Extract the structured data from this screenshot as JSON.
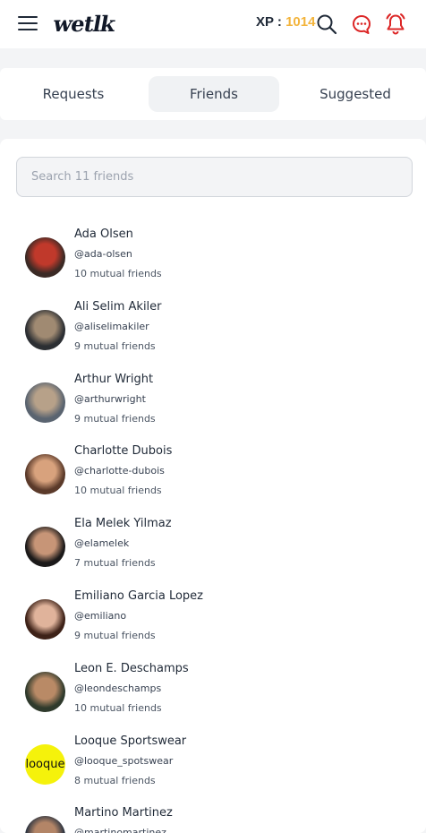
{
  "app": {
    "logo": "wetlk",
    "xp_label": "XP : ",
    "xp_value": "1014",
    "icons": [
      "menu-icon",
      "search-icon",
      "chat-icon",
      "bell-icon"
    ],
    "accent_color": "#dc2626",
    "xp_color": "#f3b43c"
  },
  "tabs": [
    {
      "label": "Requests",
      "active": false
    },
    {
      "label": "Friends",
      "active": true
    },
    {
      "label": "Suggested",
      "active": false
    }
  ],
  "search": {
    "placeholder": "Search 11 friends",
    "value": ""
  },
  "friends": [
    {
      "name": "Ada Olsen",
      "username": "@ada-olsen",
      "mutual": "10 mutual friends",
      "avatar_colors": [
        "#3b2a25",
        "#c0392b"
      ]
    },
    {
      "name": "Ali Selim Akiler",
      "username": "@aliselimakiler",
      "mutual": "9 mutual friends",
      "avatar_colors": [
        "#2c2f33",
        "#a08a72"
      ]
    },
    {
      "name": "Arthur Wright",
      "username": "@arthurwright",
      "mutual": "9 mutual friends",
      "avatar_colors": [
        "#5a6470",
        "#b7a189"
      ]
    },
    {
      "name": "Charlotte Dubois",
      "username": "@charlotte-dubois",
      "mutual": "10 mutual friends",
      "avatar_colors": [
        "#5b3a2a",
        "#d8a27d"
      ]
    },
    {
      "name": "Ela Melek Yilmaz",
      "username": "@elamelek",
      "mutual": "7 mutual friends",
      "avatar_colors": [
        "#1c1a1a",
        "#c79577"
      ]
    },
    {
      "name": "Emiliano Garcia Lopez",
      "username": "@emiliano",
      "mutual": "9 mutual friends",
      "avatar_colors": [
        "#3e2218",
        "#e0b39b"
      ]
    },
    {
      "name": "Leon E. Deschamps",
      "username": "@leondeschamps",
      "mutual": "10 mutual friends",
      "avatar_colors": [
        "#2f3a2c",
        "#b98a66"
      ]
    },
    {
      "name": "Looque Sportswear",
      "username": "@looque_spotswear",
      "mutual": "8 mutual friends",
      "avatar_text": "looque",
      "avatar_colors": [
        "#f5f20b",
        "#f5f20b"
      ]
    },
    {
      "name": "Martino Martinez",
      "username": "@martinomartinez",
      "mutual": "",
      "avatar_colors": [
        "#2a3340",
        "#b38567"
      ]
    }
  ]
}
